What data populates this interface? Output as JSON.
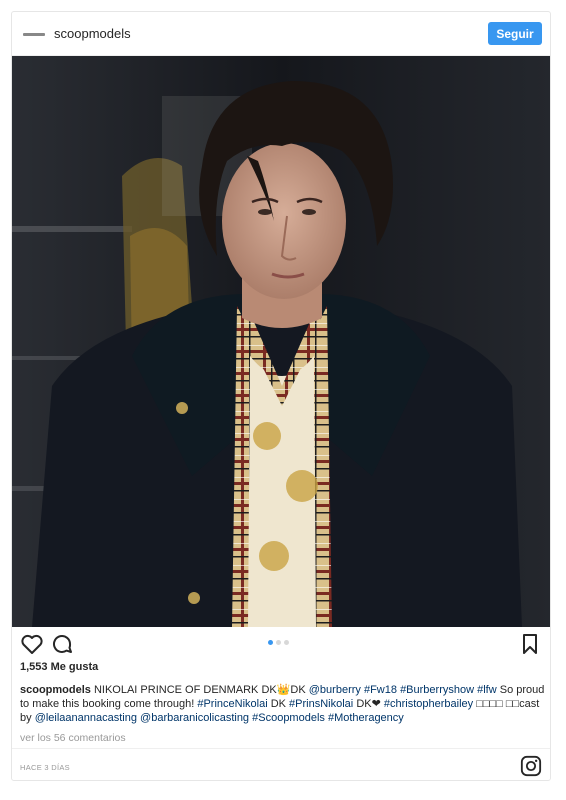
{
  "header": {
    "username": "scoopmodels",
    "follow_label": "Seguir"
  },
  "post": {
    "image_icon": "photo",
    "carousel": {
      "count": 3,
      "active": 1
    },
    "likes": "1,553 Me gusta",
    "caption": {
      "username": "scoopmodels",
      "text_1": " NIKOLAI PRINCE OF DENMARK ",
      "flags_1": "DK👑DK",
      "mention_burberry": "@burberry",
      "tag_fw18": "#Fw18",
      "tag_burberryshow": "#Burberryshow",
      "tag_lfw": "#lfw",
      "text_2": " So proud to make this booking come through! ",
      "tag_princenikolai": "#PrinceNikolai",
      "flag_2": "DK",
      "tag_prinsnikolai": "#PrinsNikolai",
      "flag_3": "DK❤",
      "tag_christopherbailey": "#christopherbailey",
      "boxes": "□□□□ □□",
      "text_3": "cast by ",
      "mention_leilaanannacasting": "@leilaanannacasting",
      "mention_barbaranicolicasting": "@barbaranicolicasting",
      "tag_scoopmodels": "#Scoopmodels",
      "tag_motheragency": "#Motheragency"
    },
    "view_comments": "ver los 56 comentarios",
    "timestamp": "HACE 3 DÍAS"
  },
  "icons": {
    "like": "heart-icon",
    "comment": "comment-icon",
    "save": "bookmark-icon",
    "instagram": "instagram-icon"
  },
  "colors": {
    "accent": "#3897f0",
    "link": "#003569",
    "muted": "#999999",
    "border": "#e6e6e6"
  }
}
